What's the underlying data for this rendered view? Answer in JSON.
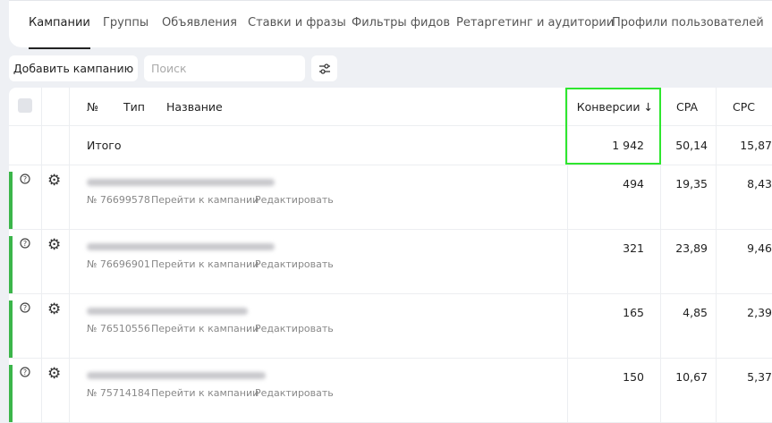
{
  "tabs": [
    "Кампании",
    "Группы",
    "Объявления",
    "Ставки и фразы",
    "Фильтры фидов",
    "Ретаргетинг и аудитории",
    "Профили пользователей"
  ],
  "toolbar": {
    "add_label": "Добавить кампанию",
    "search_placeholder": "Поиск"
  },
  "table": {
    "headers": {
      "num": "№",
      "type": "Тип",
      "name": "Название",
      "conversions": "Конверсии ↓",
      "cpa": "CPA",
      "cpc": "CPC"
    },
    "total": {
      "label": "Итого",
      "conversions": "1 942",
      "cpa": "50,14",
      "cpc": "15,87"
    },
    "rows": [
      {
        "id": "№ 76699578",
        "goto": "Перейти к кампании",
        "edit": "Редактировать",
        "conversions": "494",
        "cpa": "19,35",
        "cpc": "8,43"
      },
      {
        "id": "№ 76696901",
        "goto": "Перейти к кампании",
        "edit": "Редактировать",
        "conversions": "321",
        "cpa": "23,89",
        "cpc": "9,46"
      },
      {
        "id": "№ 76510556",
        "goto": "Перейти к кампании",
        "edit": "Редактировать",
        "conversions": "165",
        "cpa": "4,85",
        "cpc": "2,39"
      },
      {
        "id": "№ 75714184",
        "goto": "Перейти к кампании",
        "edit": "Редактировать",
        "conversions": "150",
        "cpa": "10,67",
        "cpc": "5,37"
      }
    ]
  }
}
